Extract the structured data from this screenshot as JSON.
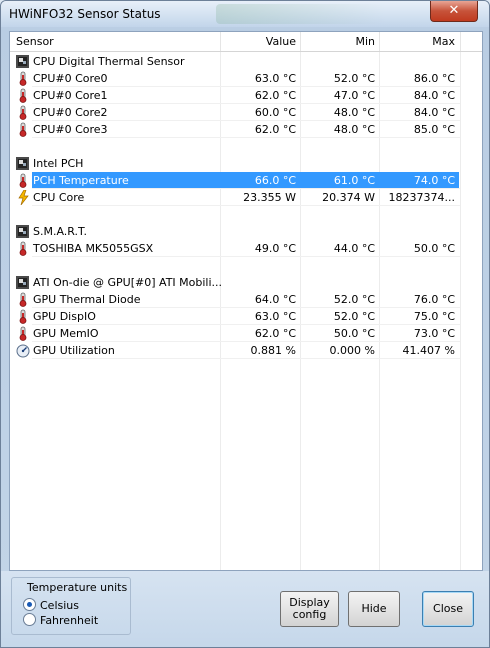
{
  "window": {
    "title": "HWiNFO32 Sensor Status"
  },
  "table": {
    "columns": [
      "Sensor",
      "Value",
      "Min",
      "Max"
    ],
    "groups": [
      {
        "name": "CPU Digital Thermal Sensor",
        "rows": [
          {
            "icon": "thermometer-icon",
            "name": "CPU#0 Core0",
            "value": "63.0 °C",
            "min": "52.0 °C",
            "max": "86.0 °C"
          },
          {
            "icon": "thermometer-icon",
            "name": "CPU#0 Core1",
            "value": "62.0 °C",
            "min": "47.0 °C",
            "max": "84.0 °C"
          },
          {
            "icon": "thermometer-icon",
            "name": "CPU#0 Core2",
            "value": "60.0 °C",
            "min": "48.0 °C",
            "max": "84.0 °C"
          },
          {
            "icon": "thermometer-icon",
            "name": "CPU#0 Core3",
            "value": "62.0 °C",
            "min": "48.0 °C",
            "max": "85.0 °C"
          }
        ]
      },
      {
        "name": "Intel PCH",
        "rows": [
          {
            "icon": "thermometer-icon",
            "name": "PCH Temperature",
            "value": "66.0 °C",
            "min": "61.0 °C",
            "max": "74.0 °C",
            "selected": true
          },
          {
            "icon": "lightning-icon",
            "name": "CPU Core",
            "value": "23.355 W",
            "min": "20.374 W",
            "max": "18237374..."
          }
        ]
      },
      {
        "name": "S.M.A.R.T.",
        "rows": [
          {
            "icon": "thermometer-icon",
            "name": "TOSHIBA MK5055GSX",
            "value": "49.0 °C",
            "min": "44.0 °C",
            "max": "50.0 °C"
          }
        ]
      },
      {
        "name": "ATI On-die @ GPU[#0] ATI Mobili...",
        "rows": [
          {
            "icon": "thermometer-icon",
            "name": "GPU Thermal Diode",
            "value": "64.0 °C",
            "min": "52.0 °C",
            "max": "76.0 °C"
          },
          {
            "icon": "thermometer-icon",
            "name": "GPU DispIO",
            "value": "63.0 °C",
            "min": "52.0 °C",
            "max": "75.0 °C"
          },
          {
            "icon": "thermometer-icon",
            "name": "GPU MemIO",
            "value": "62.0 °C",
            "min": "50.0 °C",
            "max": "73.0 °C"
          },
          {
            "icon": "gauge-icon",
            "name": "GPU Utilization",
            "value": "0.881 %",
            "min": "0.000 %",
            "max": "41.407 %"
          }
        ]
      }
    ]
  },
  "temperature_units": {
    "title": "Temperature units",
    "options": [
      {
        "label": "Celsius",
        "checked": true
      },
      {
        "label": "Fahrenheit",
        "checked": false
      }
    ]
  },
  "buttons": {
    "display_config": [
      "Display",
      "config"
    ],
    "hide": "Hide",
    "close": "Close"
  }
}
